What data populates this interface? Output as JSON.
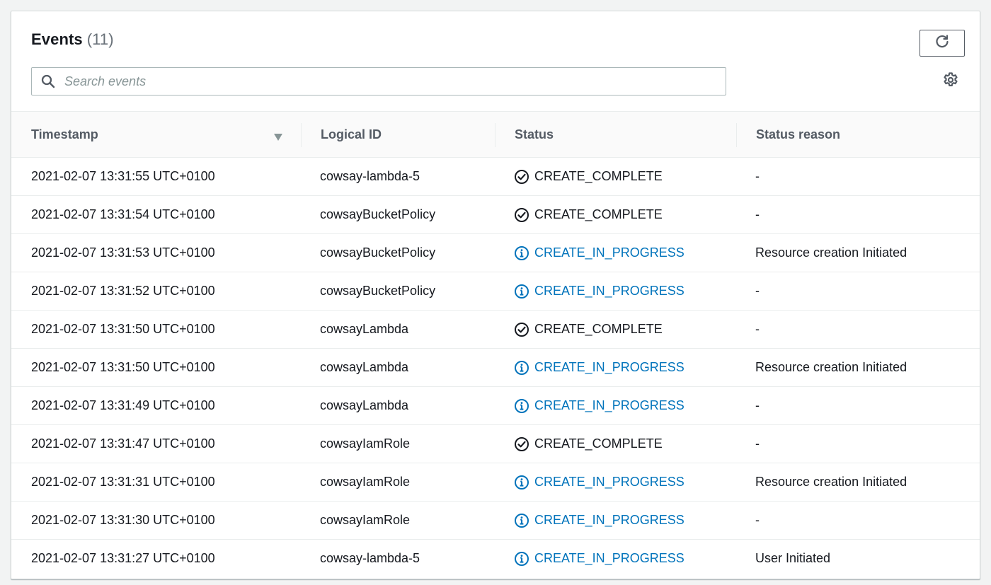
{
  "header": {
    "title": "Events",
    "count": "(11)"
  },
  "search": {
    "placeholder": "Search events",
    "value": ""
  },
  "icons": {
    "refresh": "refresh-icon",
    "settings": "gear-icon",
    "search": "search-icon",
    "sort": "sort-descending-icon",
    "success": "check-circle-icon",
    "info": "info-circle-icon"
  },
  "colors": {
    "info": "#0073bb",
    "success": "#16191f"
  },
  "table": {
    "columns": [
      "Timestamp",
      "Logical ID",
      "Status",
      "Status reason"
    ],
    "rows": [
      {
        "timestamp": "2021-02-07 13:31:55 UTC+0100",
        "logical_id": "cowsay-lambda-5",
        "status": "CREATE_COMPLETE",
        "status_type": "success",
        "reason": "-"
      },
      {
        "timestamp": "2021-02-07 13:31:54 UTC+0100",
        "logical_id": "cowsayBucketPolicy",
        "status": "CREATE_COMPLETE",
        "status_type": "success",
        "reason": "-"
      },
      {
        "timestamp": "2021-02-07 13:31:53 UTC+0100",
        "logical_id": "cowsayBucketPolicy",
        "status": "CREATE_IN_PROGRESS",
        "status_type": "info",
        "reason": "Resource creation Initiated"
      },
      {
        "timestamp": "2021-02-07 13:31:52 UTC+0100",
        "logical_id": "cowsayBucketPolicy",
        "status": "CREATE_IN_PROGRESS",
        "status_type": "info",
        "reason": "-"
      },
      {
        "timestamp": "2021-02-07 13:31:50 UTC+0100",
        "logical_id": "cowsayLambda",
        "status": "CREATE_COMPLETE",
        "status_type": "success",
        "reason": "-"
      },
      {
        "timestamp": "2021-02-07 13:31:50 UTC+0100",
        "logical_id": "cowsayLambda",
        "status": "CREATE_IN_PROGRESS",
        "status_type": "info",
        "reason": "Resource creation Initiated"
      },
      {
        "timestamp": "2021-02-07 13:31:49 UTC+0100",
        "logical_id": "cowsayLambda",
        "status": "CREATE_IN_PROGRESS",
        "status_type": "info",
        "reason": "-"
      },
      {
        "timestamp": "2021-02-07 13:31:47 UTC+0100",
        "logical_id": "cowsayIamRole",
        "status": "CREATE_COMPLETE",
        "status_type": "success",
        "reason": "-"
      },
      {
        "timestamp": "2021-02-07 13:31:31 UTC+0100",
        "logical_id": "cowsayIamRole",
        "status": "CREATE_IN_PROGRESS",
        "status_type": "info",
        "reason": "Resource creation Initiated"
      },
      {
        "timestamp": "2021-02-07 13:31:30 UTC+0100",
        "logical_id": "cowsayIamRole",
        "status": "CREATE_IN_PROGRESS",
        "status_type": "info",
        "reason": "-"
      },
      {
        "timestamp": "2021-02-07 13:31:27 UTC+0100",
        "logical_id": "cowsay-lambda-5",
        "status": "CREATE_IN_PROGRESS",
        "status_type": "info",
        "reason": "User Initiated"
      }
    ]
  }
}
